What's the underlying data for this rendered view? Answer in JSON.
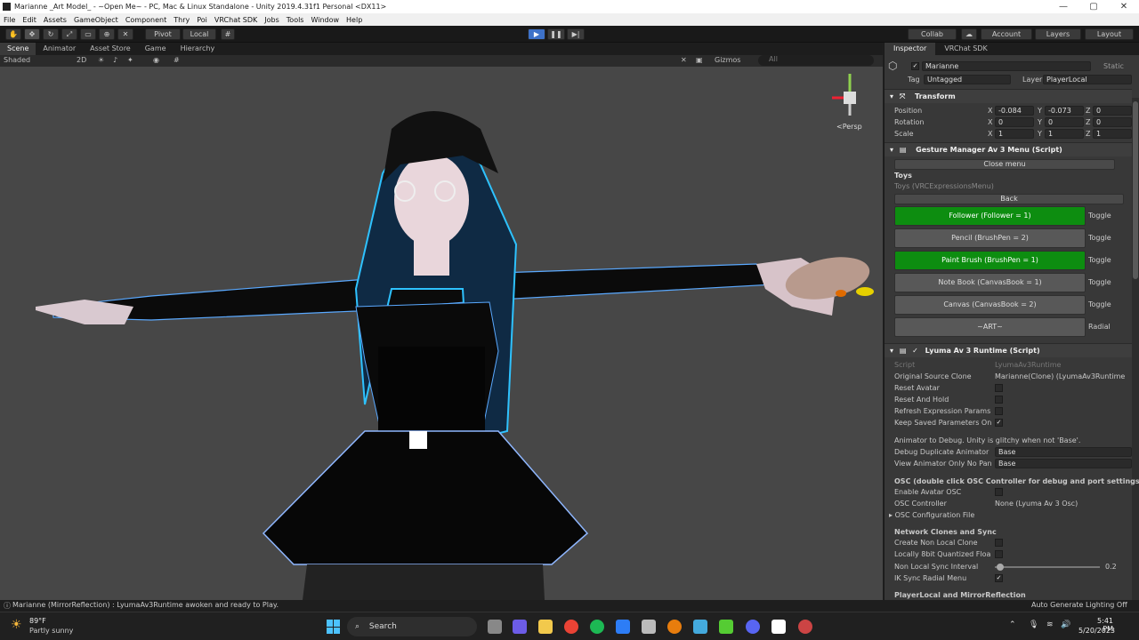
{
  "window": {
    "title": "Marianne _Art Model_ - ~Open Me~ - PC, Mac & Linux Standalone - Unity 2019.4.31f1 Personal <DX11>",
    "controls": [
      "—",
      "▢",
      "✕"
    ]
  },
  "menu": [
    "File",
    "Edit",
    "Assets",
    "GameObject",
    "Component",
    "Thry",
    "Poi",
    "VRChat SDK",
    "Jobs",
    "Tools",
    "Window",
    "Help"
  ],
  "toolbar": {
    "pivot": "Pivot",
    "local": "Local",
    "collab": "Collab",
    "account": "Account",
    "layers": "Layers",
    "layout": "Layout"
  },
  "scene": {
    "tabs": [
      "Scene",
      "Animator",
      "Asset Store",
      "Game",
      "Hierarchy"
    ],
    "shading": "Shaded",
    "mode2d": "2D",
    "gizmos": "Gizmos",
    "search_placeholder": "All",
    "persp": "<Persp"
  },
  "status": {
    "message": "Marianne (MirrorReflection) : LyumaAv3Runtime awoken and ready to Play.",
    "lighting": "Auto Generate Lighting Off"
  },
  "inspector": {
    "tabs": [
      "Inspector",
      "VRChat SDK"
    ],
    "object_name": "Marianne",
    "static_label": "Static",
    "tag_label": "Tag",
    "tag_value": "Untagged",
    "layer_label": "Layer",
    "layer_value": "PlayerLocal",
    "transform": {
      "title": "Transform",
      "position": {
        "label": "Position",
        "x": "-0.084",
        "y": "-0.073",
        "z": "0"
      },
      "rotation": {
        "label": "Rotation",
        "x": "0",
        "y": "0",
        "z": "0"
      },
      "scale": {
        "label": "Scale",
        "x": "1",
        "y": "1",
        "z": "1"
      }
    },
    "gesture": {
      "title": "Gesture Manager Av 3 Menu (Script)",
      "close": "Close menu",
      "menu_title": "Toys",
      "menu_asset": "Toys (VRCExpressionsMenu)",
      "back": "Back",
      "items": [
        {
          "label": "Follower (Follower = 1)",
          "type": "Toggle",
          "active": true
        },
        {
          "label": "Pencil (BrushPen = 2)",
          "type": "Toggle",
          "active": false
        },
        {
          "label": "Paint Brush (BrushPen = 1)",
          "type": "Toggle",
          "active": true
        },
        {
          "label": "Note Book (CanvasBook = 1)",
          "type": "Toggle",
          "active": false
        },
        {
          "label": "Canvas (CanvasBook = 2)",
          "type": "Toggle",
          "active": false
        },
        {
          "label": "~ART~",
          "type": "Radial",
          "active": false
        }
      ]
    },
    "lyuma": {
      "title": "Lyuma Av 3 Runtime (Script)",
      "script_label": "Script",
      "script_value": "LyumaAv3Runtime",
      "source_label": "Original Source Clone",
      "source_value": "Marianne(Clone) (LyumaAv3Runtime",
      "reset_avatar": "Reset Avatar",
      "reset_hold": "Reset And Hold",
      "refresh": "Refresh Expression Params",
      "keep_saved": "Keep Saved Parameters On",
      "debug_note": "Animator to Debug. Unity is glitchy when not 'Base'.",
      "debug_dup_label": "Debug Duplicate Animator",
      "debug_dup_value": "Base",
      "view_anim_label": "View Animator Only No Pan",
      "view_anim_value": "Base",
      "osc_note": "OSC (double click OSC Controller for debug and port settings)",
      "enable_osc": "Enable Avatar OSC",
      "osc_ctrl_label": "OSC Controller",
      "osc_ctrl_value": "None (Lyuma Av 3 Osc)",
      "osc_config": "OSC Configuration File",
      "net_title": "Network Clones and Sync",
      "create_clone": "Create Non Local Clone",
      "local8bit": "Locally 8bit Quantized Floa",
      "sync_interval_label": "Non Local Sync Interval",
      "sync_interval_value": "0.2",
      "sync_interval_fraction": 0.05,
      "ik_sync": "IK Sync Radial Menu",
      "playerlocal": "PlayerLocal and MirrorReflection"
    }
  },
  "taskbar": {
    "weather_temp": "89°F",
    "weather_desc": "Partly sunny",
    "search": "Search",
    "time": "5:41 PM",
    "date": "5/20/2023"
  }
}
